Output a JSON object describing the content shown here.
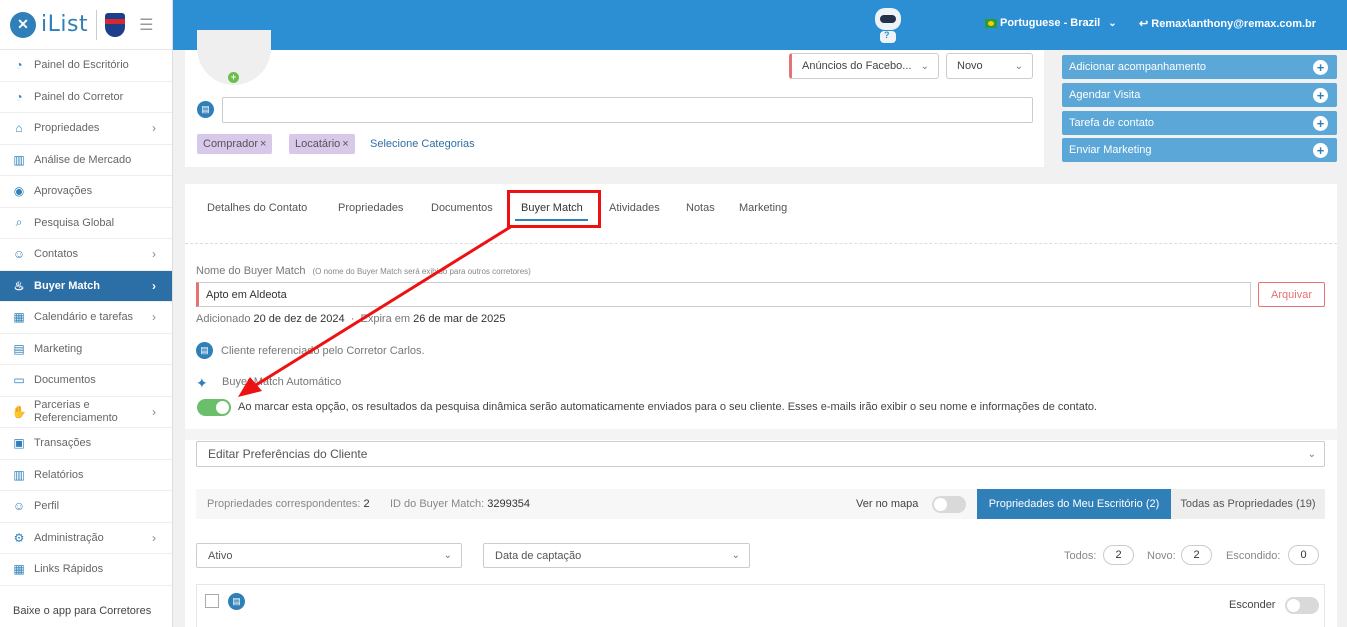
{
  "sidebar": {
    "logo_text": "iList",
    "logo_letter": "✕",
    "items": [
      {
        "label": "Painel do Escritório",
        "icon": "gauge-icon",
        "chevron": false
      },
      {
        "label": "Painel do Corretor",
        "icon": "gauge-icon",
        "chevron": false
      },
      {
        "label": "Propriedades",
        "icon": "home-icon",
        "chevron": true
      },
      {
        "label": "Análise de Mercado",
        "icon": "bar-chart-icon",
        "chevron": false
      },
      {
        "label": "Aprovações",
        "icon": "eye-icon",
        "chevron": false
      },
      {
        "label": "Pesquisa Global",
        "icon": "search-icon",
        "chevron": false
      },
      {
        "label": "Contatos",
        "icon": "user-icon",
        "chevron": true
      },
      {
        "label": "Buyer Match",
        "icon": "fire-icon",
        "chevron": true,
        "active": true
      },
      {
        "label": "Calendário e tarefas",
        "icon": "calendar-icon",
        "chevron": true
      },
      {
        "label": "Marketing",
        "icon": "newspaper-icon",
        "chevron": false
      },
      {
        "label": "Documentos",
        "icon": "folder-icon",
        "chevron": false
      },
      {
        "label": "Parcerias e Referenciamento",
        "icon": "handshake-icon",
        "chevron": true
      },
      {
        "label": "Transações",
        "icon": "briefcase-icon",
        "chevron": false
      },
      {
        "label": "Relatórios",
        "icon": "report-icon",
        "chevron": false
      },
      {
        "label": "Perfil",
        "icon": "profile-icon",
        "chevron": false
      },
      {
        "label": "Administração",
        "icon": "gear-icon",
        "chevron": true
      },
      {
        "label": "Links Rápidos",
        "icon": "grid-icon",
        "chevron": false
      }
    ],
    "app_download": "Baixe o app para Corretores"
  },
  "topbar": {
    "language": "Portuguese - Brazil",
    "user": "Remax\\anthony@remax.com.br"
  },
  "contact_card": {
    "source_select": "Anúncios do Facebo...",
    "status_select": "Novo",
    "tags": [
      "Comprador",
      "Locatário"
    ],
    "select_categories": "Selecione Categorias"
  },
  "actions": [
    "Adicionar acompanhamento",
    "Agendar Visita",
    "Tarefa de contato",
    "Enviar Marketing"
  ],
  "tabs": [
    "Detalhes do Contato",
    "Propriedades",
    "Documentos",
    "Buyer Match",
    "Atividades",
    "Notas",
    "Marketing"
  ],
  "buyer_match": {
    "name_label": "Nome do Buyer Match",
    "name_hint": "(O nome do Buyer Match será exibido para outros corretores)",
    "name_value": "Apto em Aldeota",
    "archive_label": "Arquivar",
    "added_label": "Adicionado",
    "added_date": "20 de dez de 2024",
    "expires_label": "Expira em",
    "expires_date": "26 de mar de 2025",
    "referral_text": "Cliente referenciado pelo Corretor Carlos.",
    "auto_label": "Buyer Match Automático",
    "auto_desc": "Ao marcar esta opção, os resultados da pesquisa dinâmica serão automaticamente enviados para o seu cliente. Esses e-mails irão exibir o seu nome e informações de contato.",
    "auto_on": true
  },
  "preferences_select": "Editar Preferências do Cliente",
  "stats": {
    "matching_label": "Propriedades correspondentes:",
    "matching_value": "2",
    "id_label": "ID do Buyer Match:",
    "id_value": "3299354",
    "map_label": "Ver no mapa",
    "my_office": "Propriedades do Meu Escritório (2)",
    "all_props": "Todas as Propriedades (19)"
  },
  "filters": {
    "status": "Ativo",
    "sort": "Data de captação",
    "all_label": "Todos:",
    "all_value": "2",
    "new_label": "Novo:",
    "new_value": "2",
    "hidden_label": "Escondido:",
    "hidden_value": "0",
    "hide_label": "Esconder"
  },
  "colors": {
    "primary": "#2d8fd3",
    "sidebar_active": "#2c6ea6",
    "annotation": "#e11111"
  }
}
